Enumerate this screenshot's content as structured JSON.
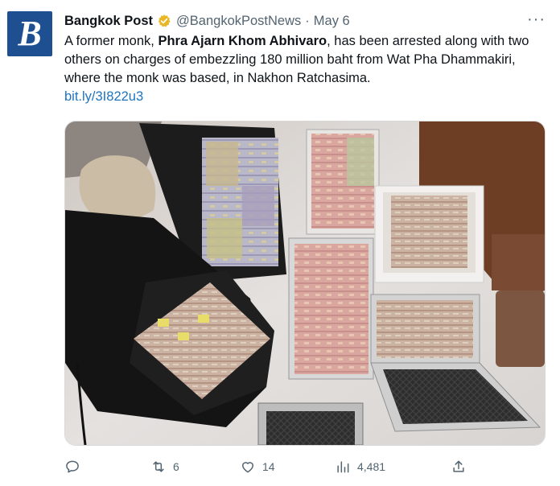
{
  "tweet": {
    "author_name": "Bangkok Post",
    "author_handle": "@BangkokPostNews",
    "separator": "·",
    "date": "May 6",
    "avatar_glyph": "B",
    "verified_icon": "gold-verified-badge",
    "more_label": "···",
    "text_part1": "A former monk, ",
    "text_bold": "Phra Ajarn Khom Abhivaro",
    "text_part2": ", has been arrested along with two others on charges of embezzling 180 million baht from Wat Pha Dhammakiri, where the monk was based, in Nakhon Ratchasima.",
    "link": "bit.ly/3I822u3"
  },
  "actions": {
    "reply_count": "",
    "retweet_count": "6",
    "like_count": "14",
    "views_count": "4,481",
    "share_count": ""
  },
  "colors": {
    "link": "#1d74bf",
    "muted": "#536471",
    "verified_gold": "#e8b829",
    "avatar_bg": "#1d4f91"
  }
}
